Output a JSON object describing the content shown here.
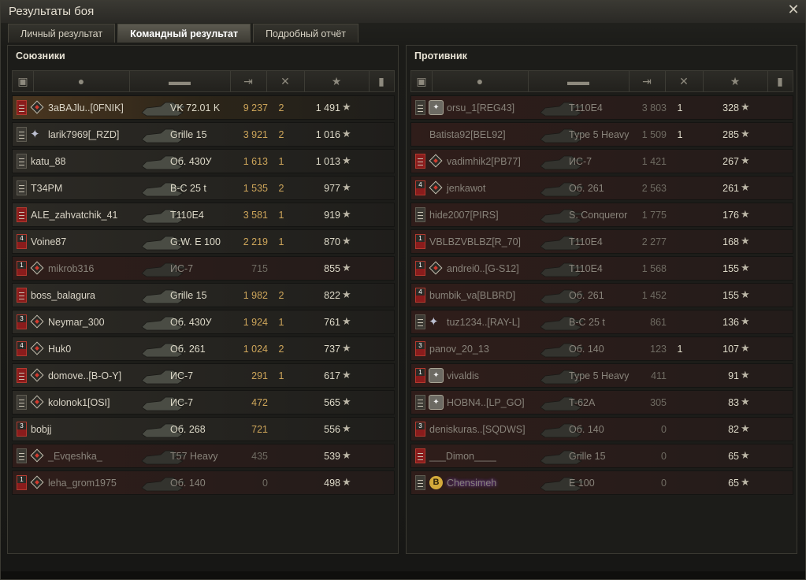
{
  "window": {
    "title": "Результаты боя",
    "close_icon": "close-icon"
  },
  "tabs": [
    {
      "label": "Личный результат",
      "active": false
    },
    {
      "label": "Командный результат",
      "active": true
    },
    {
      "label": "Подробный отчёт",
      "active": false
    }
  ],
  "teams": {
    "allies": {
      "title": "Союзники",
      "header_icons": [
        "rank-icon",
        "player-icon",
        "tank-icon",
        "damage-icon",
        "frags-icon",
        "xp-star-icon",
        "medal-icon"
      ],
      "rows": [
        {
          "name": "3aBAJlu..[0FNIK]",
          "tank": "VK 72.01 K",
          "damage": "9 237",
          "frags": "2",
          "xp": "1 491",
          "rank": "red",
          "icon": "diamond",
          "state": "self"
        },
        {
          "name": "larik7969[_RZD]",
          "tank": "Grille 15",
          "damage": "3 921",
          "frags": "2",
          "xp": "1 016",
          "rank": "grey",
          "icon": "star",
          "state": "alive"
        },
        {
          "name": "katu_88",
          "tank": "Об. 430У",
          "damage": "1 613",
          "frags": "1",
          "xp": "1 013",
          "rank": "grey",
          "icon": "none",
          "state": "alive"
        },
        {
          "name": "T34PM",
          "tank": "B-C 25 t",
          "damage": "1 535",
          "frags": "2",
          "xp": "977",
          "rank": "grey",
          "icon": "none",
          "state": "alive"
        },
        {
          "name": "ALE_zahvatchik_41",
          "tank": "T110E4",
          "damage": "3 581",
          "frags": "1",
          "xp": "919",
          "rank": "red",
          "icon": "none",
          "state": "alive"
        },
        {
          "name": "Voine87",
          "tank": "G.W. E 100",
          "damage": "2 219",
          "frags": "1",
          "xp": "870",
          "rank": "red4",
          "icon": "none",
          "state": "alive"
        },
        {
          "name": "mikrob316",
          "tank": "ИС-7",
          "damage": "715",
          "frags": "",
          "xp": "855",
          "rank": "red1",
          "icon": "diamond",
          "state": "dead"
        },
        {
          "name": "boss_balagura",
          "tank": "Grille 15",
          "damage": "1 982",
          "frags": "2",
          "xp": "822",
          "rank": "red",
          "icon": "none",
          "state": "alive"
        },
        {
          "name": "Neymar_300",
          "tank": "Об. 430У",
          "damage": "1 924",
          "frags": "1",
          "xp": "761",
          "rank": "red3",
          "icon": "diamond",
          "state": "alive"
        },
        {
          "name": "Huk0",
          "tank": "Об. 261",
          "damage": "1 024",
          "frags": "2",
          "xp": "737",
          "rank": "red4",
          "icon": "diamond",
          "state": "alive"
        },
        {
          "name": "domove..[B-O-Y]",
          "tank": "ИС-7",
          "damage": "291",
          "frags": "1",
          "xp": "617",
          "rank": "red",
          "icon": "diamond",
          "state": "alive"
        },
        {
          "name": "kolonok1[OSI]",
          "tank": "ИС-7",
          "damage": "472",
          "frags": "",
          "xp": "565",
          "rank": "grey",
          "icon": "diamond",
          "state": "alive"
        },
        {
          "name": "bobjj",
          "tank": "Об. 268",
          "damage": "721",
          "frags": "",
          "xp": "556",
          "rank": "red3",
          "icon": "none",
          "state": "alive"
        },
        {
          "name": "_Evqeshka_",
          "tank": "T57 Heavy",
          "damage": "435",
          "frags": "",
          "xp": "539",
          "rank": "grey",
          "icon": "diamond",
          "state": "dead"
        },
        {
          "name": "leha_grom1975",
          "tank": "Об. 140",
          "damage": "0",
          "frags": "",
          "xp": "498",
          "rank": "red1",
          "icon": "diamond",
          "state": "dead"
        }
      ]
    },
    "enemies": {
      "title": "Противник",
      "header_icons": [
        "rank-icon",
        "player-icon",
        "tank-icon",
        "damage-icon",
        "frags-icon",
        "xp-star-icon",
        "medal-icon"
      ],
      "rows": [
        {
          "name": "orsu_1[REG43]",
          "tank": "T110E4",
          "damage": "3 803",
          "frags": "1",
          "xp": "328",
          "rank": "grey",
          "icon": "clan",
          "state": "dead"
        },
        {
          "name": "Batista92[BEL92]",
          "tank": "Type 5 Heavy",
          "damage": "1 509",
          "frags": "1",
          "xp": "285",
          "rank": "none",
          "icon": "none",
          "state": "dead"
        },
        {
          "name": "vadimhik2[PB77]",
          "tank": "ИС-7",
          "damage": "1 421",
          "frags": "",
          "xp": "267",
          "rank": "red",
          "icon": "diamond",
          "state": "dead"
        },
        {
          "name": "jenkawot",
          "tank": "Об. 261",
          "damage": "2 563",
          "frags": "",
          "xp": "261",
          "rank": "red4",
          "icon": "diamond",
          "state": "dead"
        },
        {
          "name": "hide2007[PIRS]",
          "tank": "S. Conqueror",
          "damage": "1 775",
          "frags": "",
          "xp": "176",
          "rank": "grey",
          "icon": "none",
          "state": "dead"
        },
        {
          "name": "VBLBZVBLBZ[R_70]",
          "tank": "T110E4",
          "damage": "2 277",
          "frags": "",
          "xp": "168",
          "rank": "red1",
          "icon": "none",
          "state": "dead"
        },
        {
          "name": "andrei0..[G-S12]",
          "tank": "T110E4",
          "damage": "1 568",
          "frags": "",
          "xp": "155",
          "rank": "red1",
          "icon": "diamond",
          "state": "dead"
        },
        {
          "name": "bumbik_va[BLBRD]",
          "tank": "Об. 261",
          "damage": "1 452",
          "frags": "",
          "xp": "155",
          "rank": "red4",
          "icon": "none",
          "state": "dead"
        },
        {
          "name": "tuz1234..[RAY-L]",
          "tank": "B-C 25 t",
          "damage": "861",
          "frags": "",
          "xp": "136",
          "rank": "grey",
          "icon": "star",
          "state": "dead"
        },
        {
          "name": "panov_20_13",
          "tank": "Об. 140",
          "damage": "123",
          "frags": "1",
          "xp": "107",
          "rank": "red3",
          "icon": "none",
          "state": "dead"
        },
        {
          "name": "vivaldis",
          "tank": "Type 5 Heavy",
          "damage": "411",
          "frags": "",
          "xp": "91",
          "rank": "red1",
          "icon": "clan",
          "state": "dead"
        },
        {
          "name": "HOBN4..[LP_GO]",
          "tank": "T-62A",
          "damage": "305",
          "frags": "",
          "xp": "83",
          "rank": "grey",
          "icon": "clan",
          "state": "dead"
        },
        {
          "name": "deniskuras..[SQDWS]",
          "tank": "Об. 140",
          "damage": "0",
          "frags": "",
          "xp": "82",
          "rank": "red3",
          "icon": "none",
          "state": "dead"
        },
        {
          "name": "___Dimon____",
          "tank": "Grille 15",
          "damage": "0",
          "frags": "",
          "xp": "65",
          "rank": "red",
          "icon": "none",
          "state": "dead"
        },
        {
          "name": "Chensimeh",
          "tank": "E 100",
          "damage": "0",
          "frags": "",
          "xp": "65",
          "rank": "grey",
          "icon": "gold",
          "state": "dead",
          "badge": "B"
        }
      ]
    }
  },
  "colors": {
    "accent": "#cda55a",
    "rank_red": "#8a1c1c",
    "panel_bg": "#1c1c19"
  }
}
